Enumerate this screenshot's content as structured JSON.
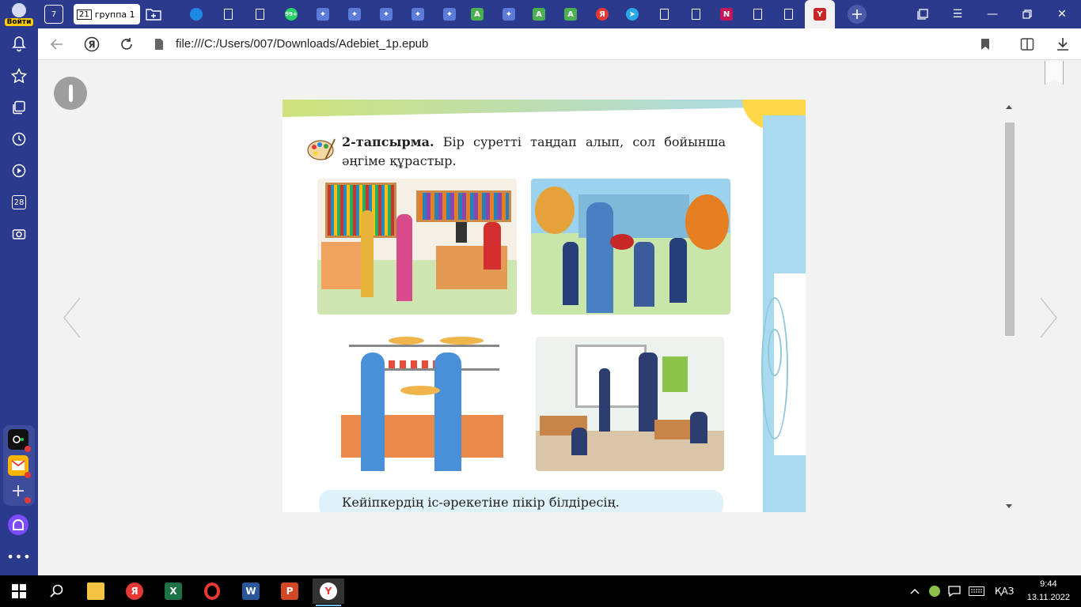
{
  "sidebar": {
    "login_label": "Войти",
    "calendar_day": "28"
  },
  "tabs": {
    "tab_count": "7",
    "group_count": "21",
    "group_label": "группа 1",
    "whatsapp_badge": "99+"
  },
  "addressbar": {
    "url": "file:///C:/Users/007/Downloads/Adebiet_1p.epub"
  },
  "page": {
    "task_bold": "2-тапсырма.",
    "task_text": " Бір суретті таңдап алып, сол бойынша әңгіме құрастыр.",
    "bottom_note": "Кейіпкердің іс-әрекетіне пікір білдіресің."
  },
  "taskbar": {
    "language": "ҚАЗ",
    "time": "9:44",
    "date": "13.11.2022"
  },
  "colors": {
    "browser_chrome": "#2b3a8c",
    "page_accent_blue": "#a9d9ee",
    "page_accent_green": "#cfe27a",
    "note_background": "#dff1f9"
  }
}
